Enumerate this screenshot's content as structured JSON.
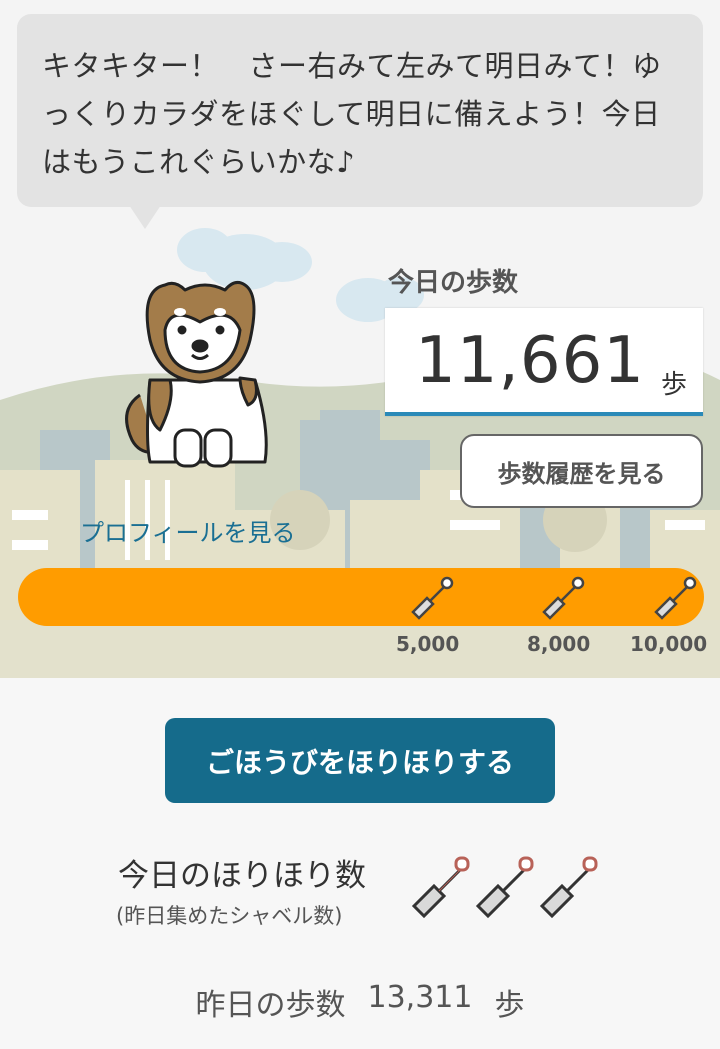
{
  "bubble": {
    "text": "キタキター！　さー右みて左みて明日みて！ゆっくりカラダをほぐして明日に備えよう！今日はもうこれぐらいかな♪"
  },
  "today": {
    "label": "今日の歩数",
    "steps": "11,661",
    "unit": "歩"
  },
  "history_button": "歩数履歴を見る",
  "profile_link": "プロフィールを見る",
  "progress": {
    "milestones": [
      {
        "label": "5,000"
      },
      {
        "label": "8,000"
      },
      {
        "label": "10,000"
      }
    ]
  },
  "reward_button": "ごほうびをほりほりする",
  "dig": {
    "title": "今日のほりほり数",
    "subtitle": "(昨日集めたシャベル数)",
    "count": 3
  },
  "yesterday": {
    "label": "昨日の歩数",
    "steps": "13,311",
    "unit": "歩"
  },
  "colors": {
    "accent": "#156b8b",
    "progress": "#ff9c00",
    "link": "#1a6f93",
    "underline": "#2a8ab8"
  }
}
